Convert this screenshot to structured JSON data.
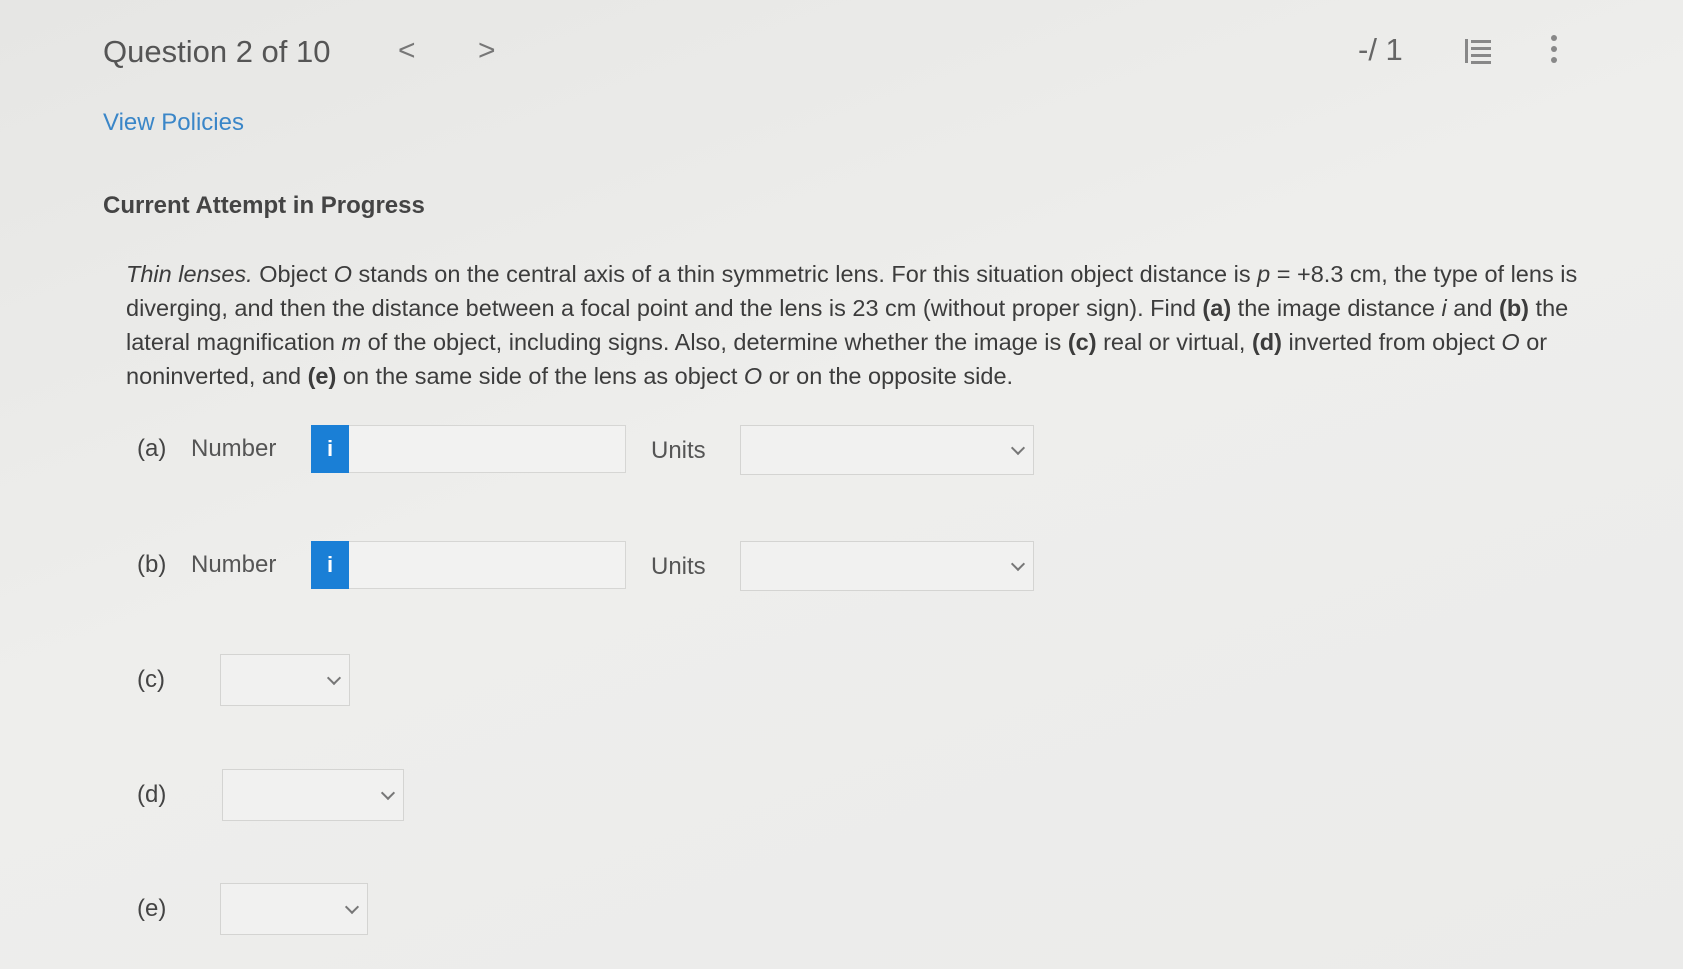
{
  "header": {
    "question_title": "Question 2 of 10",
    "prev_glyph": "<",
    "next_glyph": ">",
    "score": "-/ 1"
  },
  "links": {
    "view_policies": "View Policies"
  },
  "status": {
    "attempt": "Current Attempt in Progress"
  },
  "question": {
    "intro_italic": "Thin lenses.",
    "text_1": " Object ",
    "obj_1": "O",
    "text_2": " stands on the central axis of a thin symmetric lens. For this situation object distance is ",
    "p_var": "p",
    "text_3": " = +8.3 cm, the type of lens is diverging, and then the distance between a focal point and the lens is 23 cm (without proper sign). Find ",
    "a_tag": "(a)",
    "text_4": " the image distance ",
    "i_var": "i",
    "text_5": " and ",
    "b_tag": "(b)",
    "text_6": " the lateral magnification ",
    "m_var": "m",
    "text_7": " of the object, including signs. Also, determine whether the image is ",
    "c_tag": "(c)",
    "text_8": " real or virtual, ",
    "d_tag": "(d)",
    "text_9": " inverted from object ",
    "obj_2": "O",
    "text_10": " or noninverted, and ",
    "e_tag": "(e)",
    "text_11": " on the same side of the lens as object ",
    "obj_3": "O",
    "text_12": " or on the opposite side."
  },
  "answers": {
    "a": {
      "label": "(a)",
      "number_label": "Number",
      "info_glyph": "i",
      "value": "",
      "units_label": "Units",
      "units_value": ""
    },
    "b": {
      "label": "(b)",
      "number_label": "Number",
      "info_glyph": "i",
      "value": "",
      "units_label": "Units",
      "units_value": ""
    },
    "c": {
      "label": "(c)",
      "value": ""
    },
    "d": {
      "label": "(d)",
      "value": ""
    },
    "e": {
      "label": "(e)",
      "value": ""
    }
  },
  "colors": {
    "link": "#3a86c8",
    "info_button": "#1a7fd6"
  },
  "icons": {
    "list": "list-numbered-icon",
    "menu": "kebab-menu-icon"
  }
}
